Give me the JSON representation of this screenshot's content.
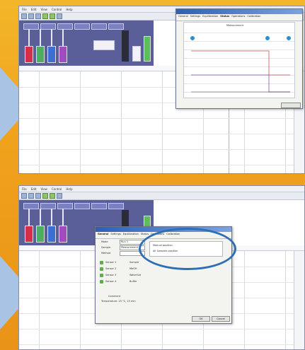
{
  "menu": {
    "file": "File",
    "edit": "Edit",
    "view": "View",
    "control": "Control",
    "help": "Help"
  },
  "panel": {
    "label": "Measurement"
  },
  "dialog_top": {
    "tabs": [
      "General",
      "Settings",
      "Equilibration",
      "Status",
      "Operations",
      "Calibration"
    ],
    "status": "Measurement"
  },
  "dialog_bottom": {
    "tabs": [
      "General",
      "Settings",
      "Equilibration",
      "Status",
      "Operations",
      "Calibration"
    ],
    "rows": [
      {
        "label": "Mode",
        "value": "Run 1"
      },
      {
        "label": "Sample",
        "value": "Measurement"
      },
      {
        "label": "Method",
        "value": ""
      }
    ],
    "options": [
      "Manual position",
      "All Samples position"
    ],
    "sensors": [
      "Sensor 1",
      "Sensor 2",
      "Sensor 3",
      "Sensor 4"
    ],
    "sensor_values": [
      "Sample",
      "MeOH",
      "WaterSat",
      "Buffer"
    ],
    "comment_label": "Comment",
    "comment_value": "Temperature: 25 °C, 15 min",
    "ok": "OK",
    "cancel": "Cancel"
  },
  "colors": {
    "accent": "#2e6fb3",
    "schematic": "#5a5f9a",
    "background": "#f0a21c"
  }
}
